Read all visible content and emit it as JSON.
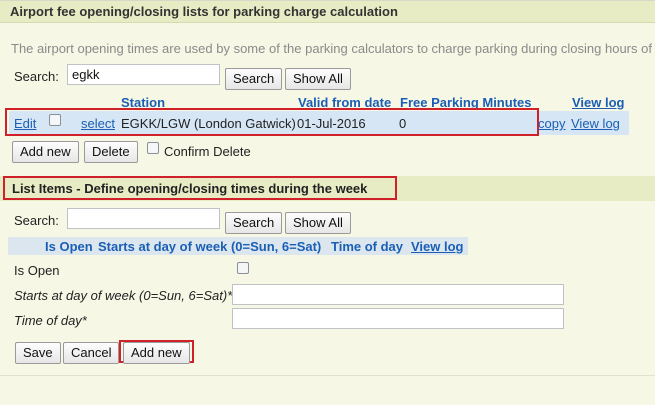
{
  "fee_panel": {
    "title": "Airport fee opening/closing lists for parking charge calculation",
    "description": "The airport opening times are used by some of the parking calculators to charge parking during closing hours of",
    "search_label": "Search:",
    "search_value": "egkk",
    "search_button": "Search",
    "show_all_button": "Show All",
    "columns": {
      "station": "Station",
      "valid_from": "Valid from date",
      "free_parking": "Free Parking Minutes",
      "view_log": "View log"
    },
    "row": {
      "edit": "Edit",
      "select": "select",
      "station": "EGKK/LGW (London Gatwick)",
      "valid_from": "01-Jul-2016",
      "free_parking": "0",
      "copy": "copy",
      "view_log": "View log"
    },
    "add_new_button": "Add new",
    "delete_button": "Delete",
    "confirm_delete_label": "Confirm Delete"
  },
  "list_panel": {
    "title": "List Items - Define opening/closing times during the week",
    "search_label": "Search:",
    "search_value": "",
    "search_button": "Search",
    "show_all_button": "Show All",
    "columns": {
      "is_open": "Is Open",
      "starts_at": "Starts at day of week (0=Sun, 6=Sat)",
      "time_of_day": "Time of day",
      "view_log": "View log"
    },
    "form": {
      "is_open_label": "Is Open",
      "starts_at_label": "Starts at day of week (0=Sun, 6=Sat)*",
      "starts_at_value": "",
      "time_of_day_label": "Time of day*",
      "time_of_day_value": ""
    },
    "save_button": "Save",
    "cancel_button": "Cancel",
    "add_new_button": "Add new"
  }
}
